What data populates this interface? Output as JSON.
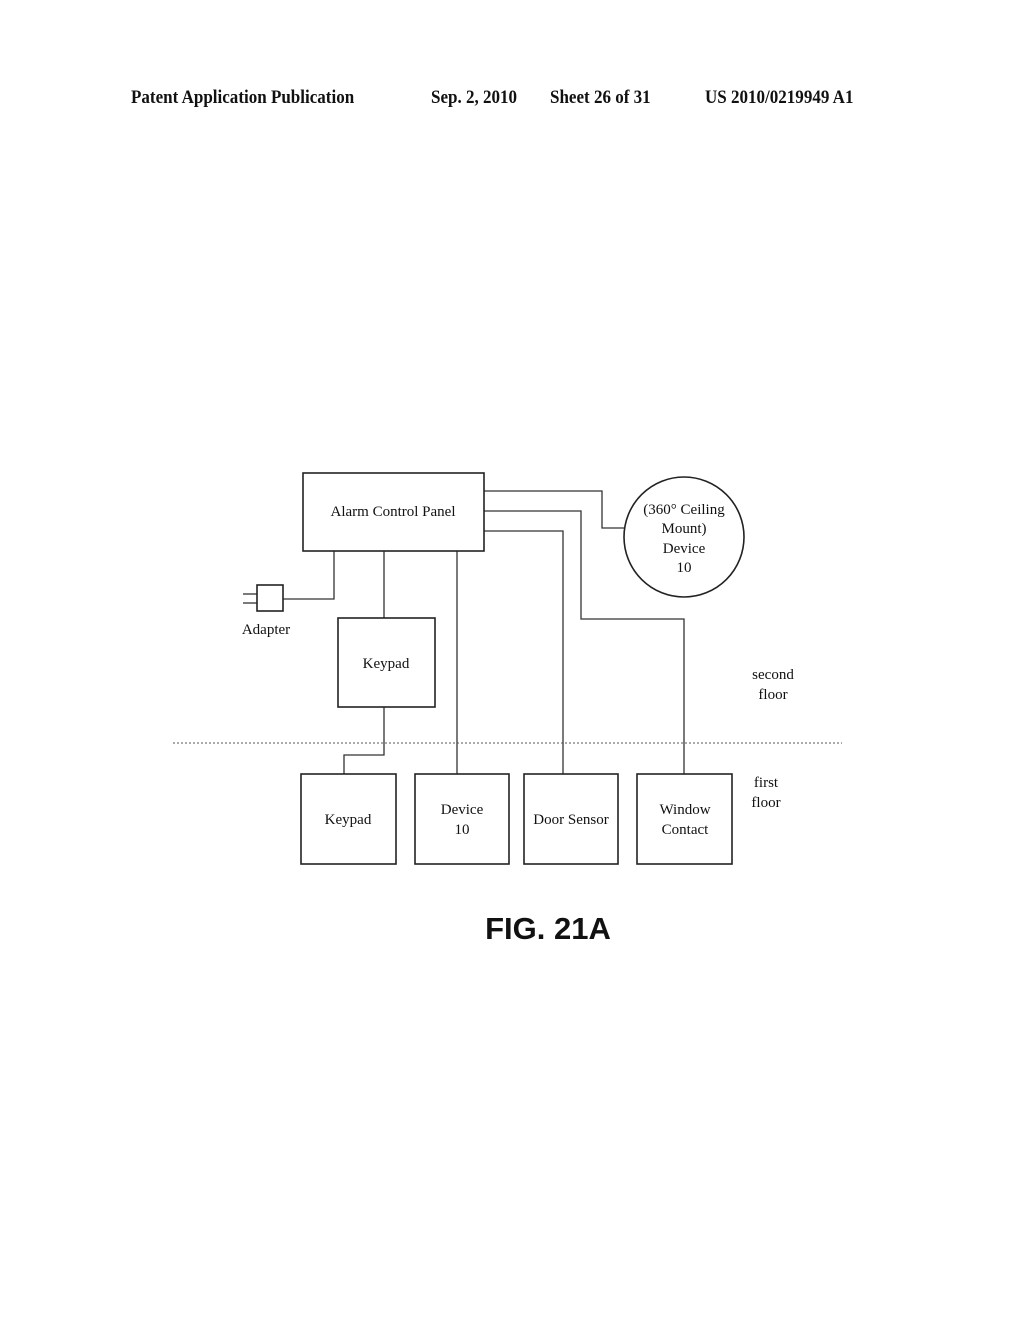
{
  "header": {
    "publication": "Patent Application Publication",
    "date": "Sep. 2, 2010",
    "sheet": "Sheet 26 of 31",
    "number": "US 2010/0219949 A1"
  },
  "diagram": {
    "alarm_panel": "Alarm Control Panel",
    "ceiling_device": [
      "(360° Ceiling",
      "Mount)",
      "Device",
      "10"
    ],
    "adapter": "Adapter",
    "keypad_upper": "Keypad",
    "floor_labels": {
      "second": [
        "second",
        "floor"
      ],
      "first": [
        "first",
        "floor"
      ]
    },
    "first_floor_devices": [
      {
        "lines": [
          "Keypad"
        ]
      },
      {
        "lines": [
          "Device",
          "10"
        ]
      },
      {
        "lines": [
          "Door Sensor"
        ]
      },
      {
        "lines": [
          "Window",
          "Contact"
        ]
      }
    ],
    "connections": [
      [
        "Alarm Control Panel",
        "(360° Ceiling Mount) Device 10"
      ],
      [
        "Alarm Control Panel",
        "Window Contact"
      ],
      [
        "Alarm Control Panel",
        "Door Sensor"
      ],
      [
        "Alarm Control Panel",
        "Device 10"
      ],
      [
        "Alarm Control Panel",
        "Keypad (second floor)"
      ],
      [
        "Alarm Control Panel",
        "Adapter"
      ],
      [
        "Keypad (second floor)",
        "Keypad (first floor)"
      ]
    ]
  },
  "figure_label": "FIG. 21A"
}
